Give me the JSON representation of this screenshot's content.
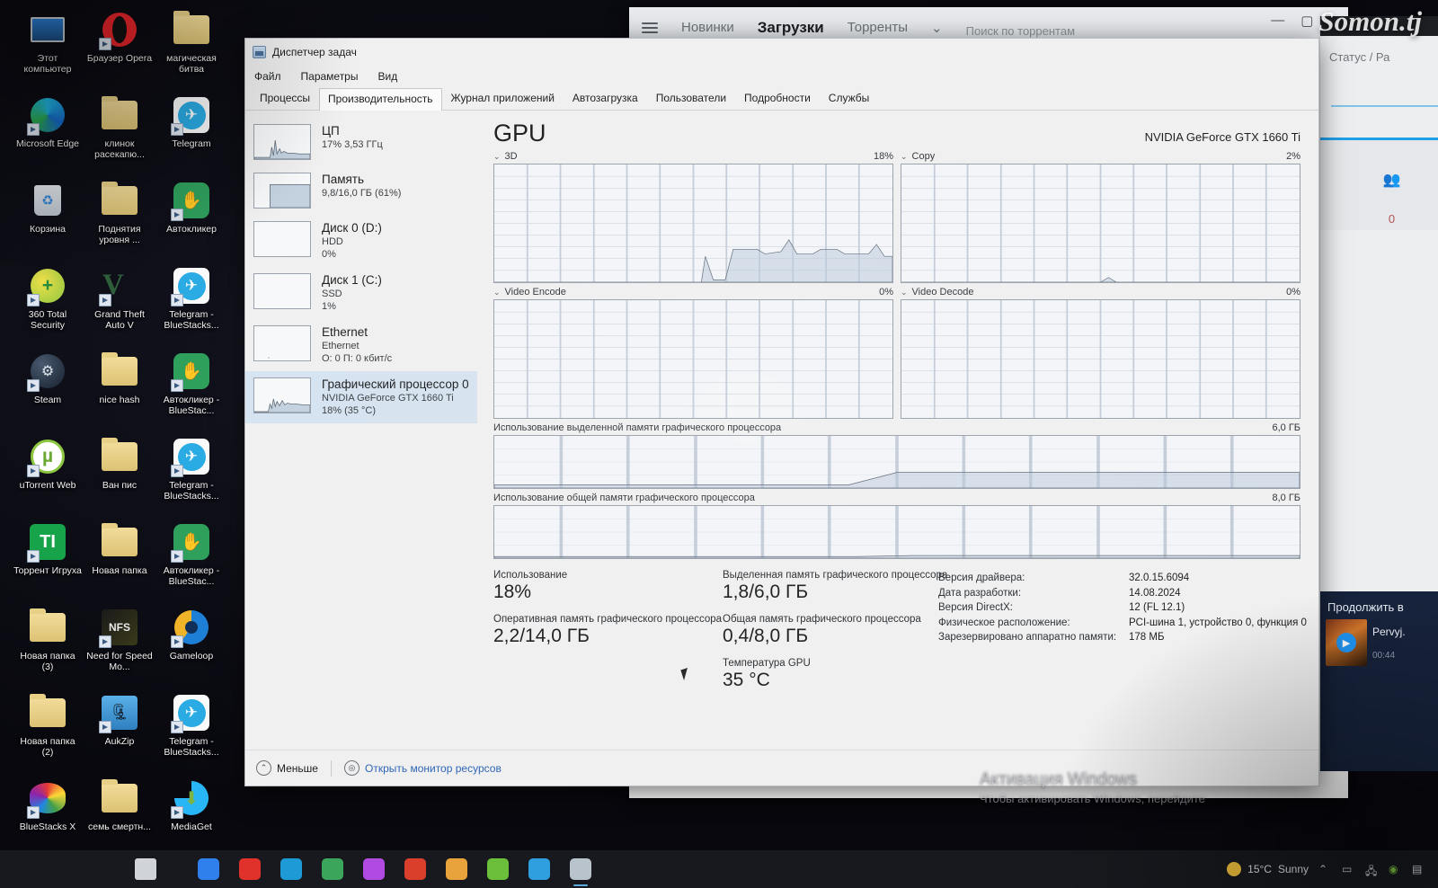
{
  "desktop": {
    "icons": [
      {
        "label": "Этот компьютер",
        "icon": "computer-icon",
        "shortcut": false
      },
      {
        "label": "Браузер Opera",
        "icon": "opera-icon",
        "shortcut": true
      },
      {
        "label": "магическая битва",
        "icon": "folder-icon",
        "shortcut": false
      },
      {
        "label": "Microsoft Edge",
        "icon": "edge-icon",
        "shortcut": true
      },
      {
        "label": "клинок расекапю...",
        "icon": "folder-icon",
        "shortcut": false
      },
      {
        "label": "Telegram",
        "icon": "telegram-icon",
        "shortcut": true
      },
      {
        "label": "Корзина",
        "icon": "recycle-bin-icon",
        "shortcut": false
      },
      {
        "label": "Поднятия уровня ...",
        "icon": "folder-icon",
        "shortcut": false
      },
      {
        "label": "Автокликер",
        "icon": "autoclicker-icon",
        "shortcut": true
      },
      {
        "label": "360 Total Security",
        "icon": "360-security-icon",
        "shortcut": true
      },
      {
        "label": "Grand Theft Auto V",
        "icon": "gta-v-icon",
        "shortcut": true
      },
      {
        "label": "Telegram - BlueStacks...",
        "icon": "telegram-icon",
        "shortcut": true
      },
      {
        "label": "Steam",
        "icon": "steam-icon",
        "shortcut": true
      },
      {
        "label": "nice hash",
        "icon": "folder-icon",
        "shortcut": false
      },
      {
        "label": "Автокликер - BlueStac...",
        "icon": "autoclicker-icon",
        "shortcut": true
      },
      {
        "label": "uTorrent Web",
        "icon": "utorrent-icon",
        "shortcut": true
      },
      {
        "label": "Ван пис",
        "icon": "folder-icon",
        "shortcut": false
      },
      {
        "label": "Telegram - BlueStacks...",
        "icon": "telegram-icon",
        "shortcut": true
      },
      {
        "label": "Торрент Игруха",
        "icon": "torrent-igruha-icon",
        "shortcut": true
      },
      {
        "label": "Новая папка",
        "icon": "folder-icon",
        "shortcut": false
      },
      {
        "label": "Автокликер - BlueStac...",
        "icon": "autoclicker-icon",
        "shortcut": true
      },
      {
        "label": "Новая папка (3)",
        "icon": "folder-icon",
        "shortcut": false
      },
      {
        "label": "Need for Speed Mo...",
        "icon": "nfs-icon",
        "shortcut": true
      },
      {
        "label": "Gameloop",
        "icon": "gameloop-icon",
        "shortcut": true
      },
      {
        "label": "Новая папка (2)",
        "icon": "folder-icon",
        "shortcut": false
      },
      {
        "label": "AukZip",
        "icon": "aukzip-icon",
        "shortcut": true
      },
      {
        "label": "Telegram - BlueStacks...",
        "icon": "telegram-icon",
        "shortcut": true
      },
      {
        "label": "BlueStacks X",
        "icon": "bluestacks-icon",
        "shortcut": true
      },
      {
        "label": "семь смертн...",
        "icon": "folder-icon",
        "shortcut": false
      },
      {
        "label": "MediaGet",
        "icon": "mediaget-icon",
        "shortcut": true
      }
    ]
  },
  "background_torrent_window": {
    "nav": [
      "Новинки",
      "Загрузки",
      "Торренты"
    ],
    "active_nav": "Загрузки",
    "dropdown_caret": "⌄",
    "search_placeholder": "Поиск по торрентам"
  },
  "background_right_panel": {
    "header": "Статус / Ра",
    "peers_count": "0",
    "continue_title": "Продолжить в",
    "card_title": "Pervyj.",
    "card_time": "00:44"
  },
  "taskmanager": {
    "window_title": "Диспетчер задач",
    "menu": [
      "Файл",
      "Параметры",
      "Вид"
    ],
    "tabs": [
      {
        "label": "Процессы",
        "active": false
      },
      {
        "label": "Производительность",
        "active": true
      },
      {
        "label": "Журнал приложений",
        "active": false
      },
      {
        "label": "Автозагрузка",
        "active": false
      },
      {
        "label": "Пользователи",
        "active": false
      },
      {
        "label": "Подробности",
        "active": false
      },
      {
        "label": "Службы",
        "active": false
      }
    ],
    "resources": [
      {
        "name": "ЦП",
        "sub1": "17% 3,53 ГГц",
        "sub2": "",
        "selected": false
      },
      {
        "name": "Память",
        "sub1": "9,8/16,0 ГБ (61%)",
        "sub2": "",
        "selected": false
      },
      {
        "name": "Диск 0 (D:)",
        "sub1": "HDD",
        "sub2": "0%",
        "selected": false
      },
      {
        "name": "Диск 1 (C:)",
        "sub1": "SSD",
        "sub2": "1%",
        "selected": false
      },
      {
        "name": "Ethernet",
        "sub1": "Ethernet",
        "sub2": "О: 0 П: 0 кбит/с",
        "selected": false
      },
      {
        "name": "Графический процессор 0",
        "sub1": "NVIDIA GeForce GTX 1660 Ti",
        "sub2": "18%  (35 °C)",
        "selected": true
      }
    ],
    "header": {
      "title": "GPU",
      "model": "NVIDIA GeForce GTX 1660 Ti"
    },
    "graphs": [
      {
        "name": "3D",
        "value": "18%"
      },
      {
        "name": "Copy",
        "value": "2%"
      },
      {
        "name": "Video Encode",
        "value": "0%"
      },
      {
        "name": "Video Decode",
        "value": "0%"
      },
      {
        "name": "Использование выделенной памяти графического процессора",
        "value": "6,0 ГБ"
      },
      {
        "name": "Использование общей памяти графического процессора",
        "value": "8,0 ГБ"
      }
    ],
    "stats": [
      {
        "label": "Использование",
        "value": "18%"
      },
      {
        "label": "Оперативная память графического процессора",
        "value": "2,2/14,0 ГБ"
      },
      {
        "label": "Выделенная память графического процессора",
        "value": "1,8/6,0 ГБ"
      },
      {
        "label": "Общая память графического процессора",
        "value": "0,4/8,0 ГБ"
      },
      {
        "label": "Температура GPU",
        "value": "35 °C"
      }
    ],
    "info": [
      {
        "key": "Версия драйвера:",
        "value": "32.0.15.6094"
      },
      {
        "key": "Дата разработки:",
        "value": "14.08.2024"
      },
      {
        "key": "Версия DirectX:",
        "value": "12 (FL 12.1)"
      },
      {
        "key": "Физическое расположение:",
        "value": "PCI-шина 1, устройство 0, функция 0"
      },
      {
        "key": "Зарезервировано аппаратно памяти:",
        "value": "178 МБ"
      }
    ],
    "footer": {
      "less_label": "Меньше",
      "monitor_label": "Открыть монитор ресурсов"
    }
  },
  "overlays": {
    "watermark": "Somon.tj",
    "activation_line1": "Активация Windows",
    "activation_line2": "Чтобы активировать Windows, перейдите"
  },
  "taskbar": {
    "weather_temp": "15°C",
    "weather_desc": "Sunny"
  },
  "chart_data": [
    {
      "type": "line",
      "title": "3D",
      "ylabel": "%",
      "ylim": [
        0,
        100
      ],
      "value_label": "18%",
      "x": [
        0,
        5,
        10,
        15,
        20,
        25,
        30,
        35,
        40,
        45,
        50,
        52,
        55,
        58,
        60,
        63,
        66,
        70,
        74,
        78,
        82,
        86,
        90,
        94,
        98,
        100
      ],
      "values": [
        0,
        0,
        0,
        0,
        0,
        0,
        0,
        0,
        0,
        0,
        0,
        0,
        12,
        2,
        2,
        20,
        20,
        16,
        18,
        30,
        20,
        18,
        18,
        22,
        16,
        18
      ]
    },
    {
      "type": "line",
      "title": "Copy",
      "ylabel": "%",
      "ylim": [
        0,
        100
      ],
      "value_label": "2%",
      "x": [
        0,
        20,
        40,
        52,
        55,
        58,
        62,
        70,
        80,
        90,
        100
      ],
      "values": [
        0,
        0,
        0,
        0,
        4,
        0,
        0,
        0,
        0,
        0,
        0
      ]
    },
    {
      "type": "line",
      "title": "Video Encode",
      "ylabel": "%",
      "ylim": [
        0,
        100
      ],
      "value_label": "0%",
      "x": [
        0,
        50,
        100
      ],
      "values": [
        0,
        0,
        0
      ]
    },
    {
      "type": "line",
      "title": "Video Decode",
      "ylabel": "%",
      "ylim": [
        0,
        100
      ],
      "value_label": "0%",
      "x": [
        0,
        50,
        100
      ],
      "values": [
        0,
        0,
        0
      ]
    },
    {
      "type": "area",
      "title": "Использование выделенной памяти графического процессора",
      "ylabel": "ГБ",
      "ylim": [
        0,
        6.0
      ],
      "value_label": "6,0 ГБ",
      "x": [
        0,
        40,
        48,
        52,
        60,
        80,
        100
      ],
      "values": [
        0.35,
        0.35,
        0.4,
        1.7,
        1.8,
        1.8,
        1.8
      ]
    },
    {
      "type": "area",
      "title": "Использование общей памяти графического процессора",
      "ylabel": "ГБ",
      "ylim": [
        0,
        8.0
      ],
      "value_label": "8,0 ГБ",
      "x": [
        0,
        40,
        50,
        60,
        80,
        100
      ],
      "values": [
        0.2,
        0.2,
        0.3,
        0.4,
        0.4,
        0.4
      ]
    }
  ]
}
